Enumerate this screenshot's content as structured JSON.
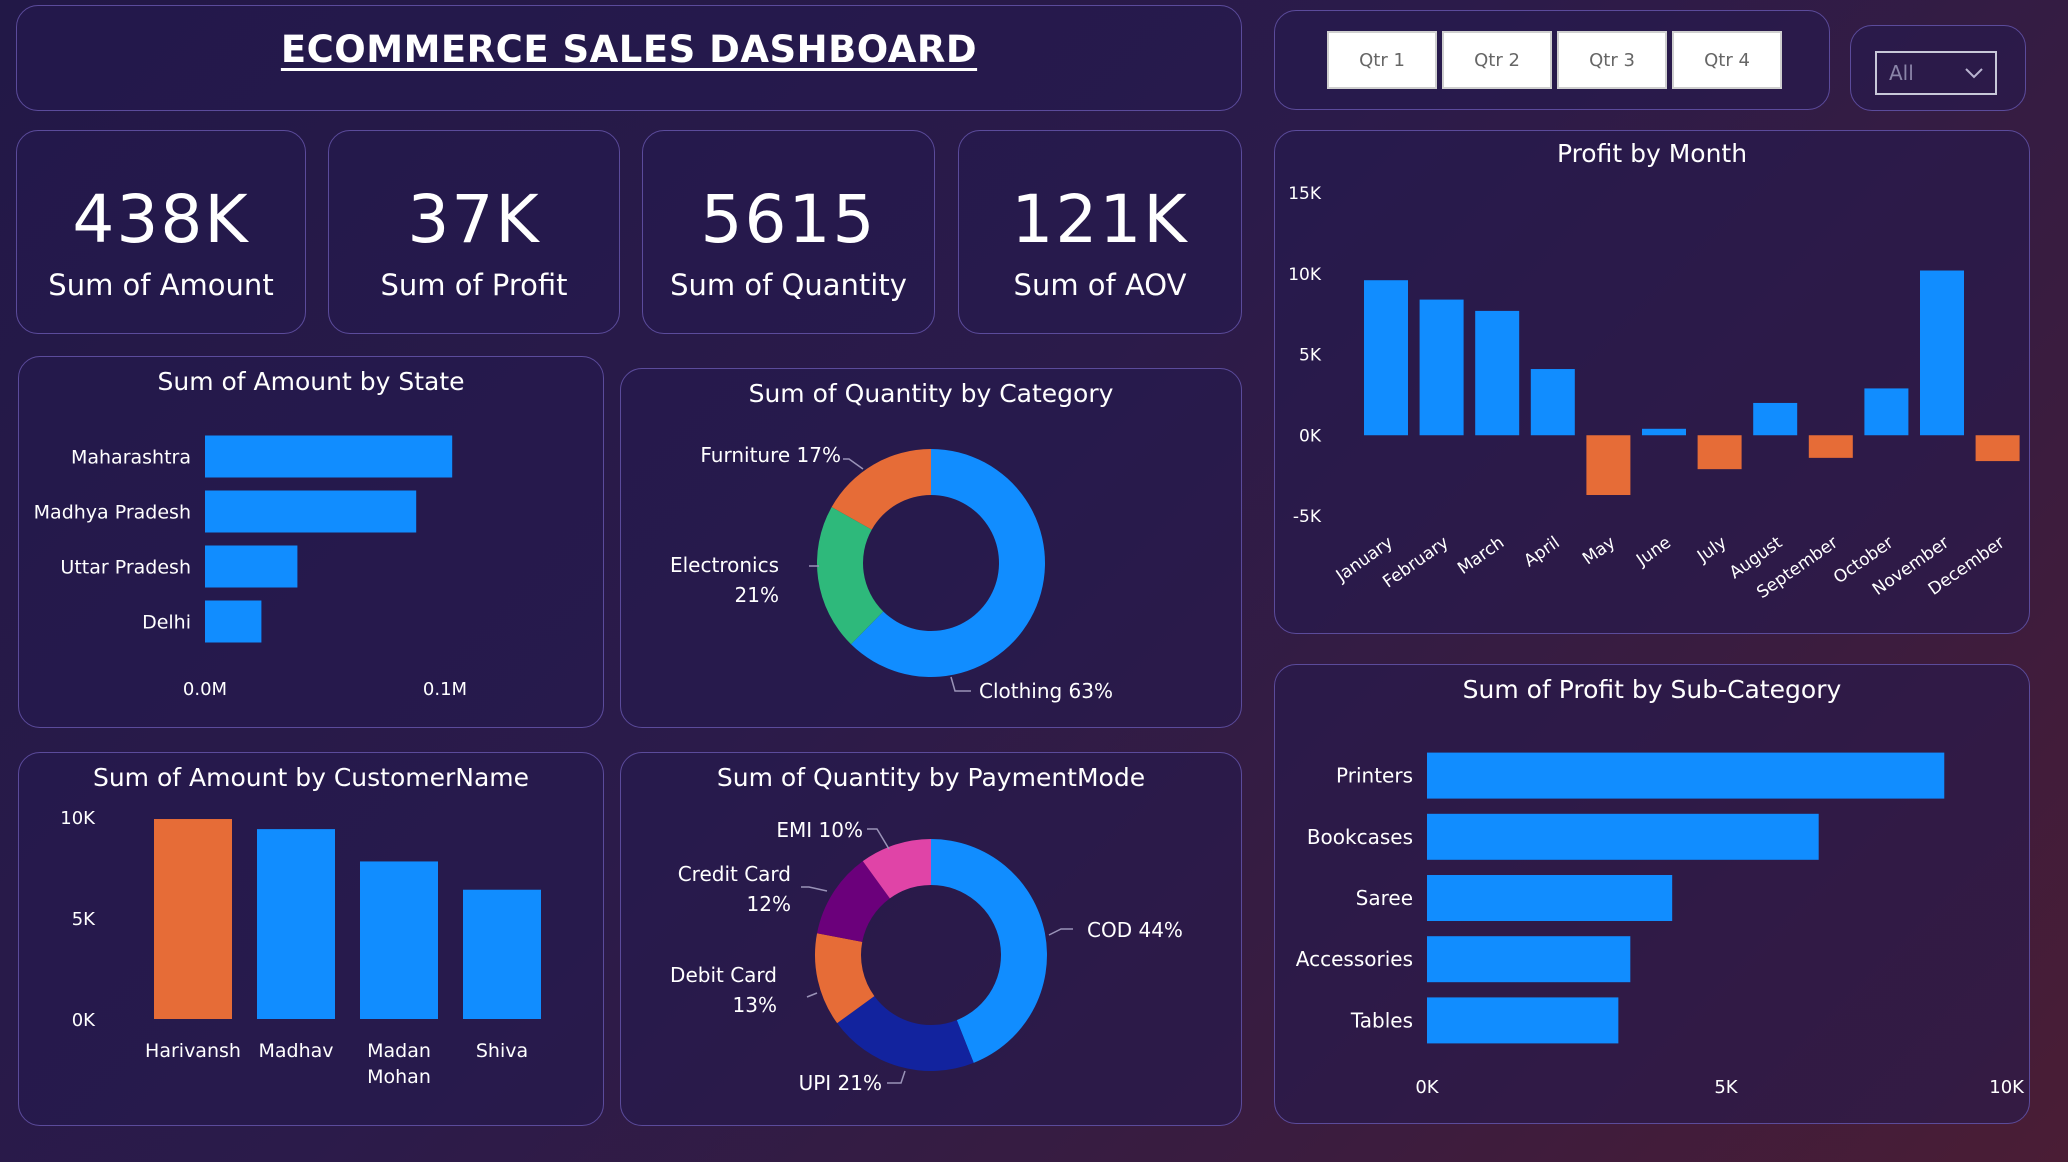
{
  "dashboard": {
    "title": "ECOMMERCE SALES DASHBOARD"
  },
  "kpis": [
    {
      "value": "438K",
      "label": "Sum of Amount"
    },
    {
      "value": "37K",
      "label": "Sum of Profit"
    },
    {
      "value": "5615",
      "label": "Sum of Quantity"
    },
    {
      "value": "121K",
      "label": "Sum of AOV"
    }
  ],
  "filters": {
    "quarters": [
      "Qtr 1",
      "Qtr 2",
      "Qtr 3",
      "Qtr 4"
    ],
    "dropdown_value": "All"
  },
  "colors": {
    "blue": "#118DFF",
    "orange": "#E66C37",
    "green": "#2EB97B",
    "navy": "#12239E",
    "purple": "#6B007B",
    "pink": "#E044A7"
  },
  "chart_data": [
    {
      "id": "state",
      "type": "bar",
      "orientation": "horizontal",
      "title": "Sum of Amount by State",
      "categories": [
        "Maharashtra",
        "Madhya Pradesh",
        "Uttar Pradesh",
        "Delhi"
      ],
      "values": [
        103000,
        88000,
        38500,
        23500
      ],
      "xlim": [
        0,
        100000
      ],
      "xticks": [
        "0.0M",
        "0.1M"
      ]
    },
    {
      "id": "category",
      "type": "pie",
      "title": "Sum of Quantity by Category",
      "labels": [
        "Clothing",
        "Electronics",
        "Furniture"
      ],
      "values": [
        63,
        21,
        17
      ],
      "label_text": [
        "Clothing 63%",
        "Electronics 21%",
        "Furniture 17%"
      ],
      "colors": [
        "#118DFF",
        "#2EB97B",
        "#E66C37"
      ]
    },
    {
      "id": "customer",
      "type": "bar",
      "title": "Sum of Amount by CustomerName",
      "categories": [
        "Harivansh",
        "Madhav",
        "Madan Mohan",
        "Shiva"
      ],
      "values": [
        9900,
        9400,
        7800,
        6400
      ],
      "highlight": [
        true,
        false,
        false,
        false
      ],
      "ylim": [
        0,
        10000
      ],
      "yticks": [
        "0K",
        "5K",
        "10K"
      ]
    },
    {
      "id": "payment",
      "type": "pie",
      "title": "Sum of Quantity by PaymentMode",
      "labels": [
        "COD",
        "UPI",
        "Debit Card",
        "Credit Card",
        "EMI"
      ],
      "values": [
        44,
        21,
        13,
        12,
        10
      ],
      "label_text": [
        "COD 44%",
        "UPI 21%",
        "Debit Card 13%",
        "Credit Card 12%",
        "EMI 10%"
      ],
      "colors": [
        "#118DFF",
        "#12239E",
        "#E66C37",
        "#6B007B",
        "#E044A7"
      ]
    },
    {
      "id": "month",
      "type": "bar",
      "title": "Profit by Month",
      "categories": [
        "January",
        "February",
        "March",
        "April",
        "May",
        "June",
        "July",
        "August",
        "September",
        "October",
        "November",
        "December"
      ],
      "values": [
        9600,
        8400,
        7700,
        4100,
        -3700,
        400,
        -2100,
        2000,
        -1400,
        2900,
        10200,
        -1600
      ],
      "ylim": [
        -5000,
        15000
      ],
      "yticks": [
        "-5K",
        "0K",
        "5K",
        "10K",
        "15K"
      ]
    },
    {
      "id": "subcat",
      "type": "bar",
      "orientation": "horizontal",
      "title": "Sum of Profit by Sub-Category",
      "categories": [
        "Printers",
        "Bookcases",
        "Saree",
        "Accessories",
        "Tables"
      ],
      "values": [
        8650,
        6550,
        4100,
        3400,
        3200
      ],
      "xlim": [
        0,
        10000
      ],
      "xticks": [
        "0K",
        "5K",
        "10K"
      ]
    }
  ]
}
